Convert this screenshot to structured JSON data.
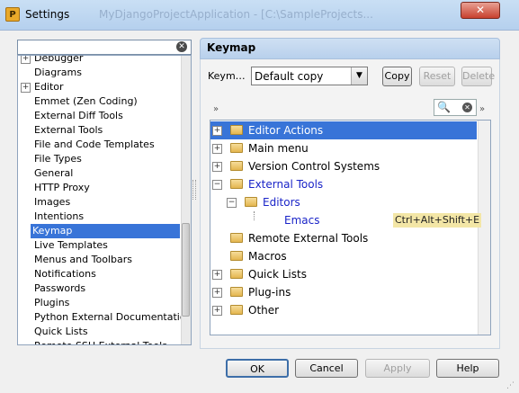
{
  "window": {
    "title": "Settings",
    "background_title": "MyDjangoProjectApplication - [C:\\SampleProjects..."
  },
  "search": {
    "value": "",
    "placeholder": ""
  },
  "settings_tree": [
    {
      "label": "Debugger",
      "expandable": true
    },
    {
      "label": "Diagrams"
    },
    {
      "label": "Editor",
      "expandable": true
    },
    {
      "label": "Emmet (Zen Coding)"
    },
    {
      "label": "External Diff Tools"
    },
    {
      "label": "External Tools"
    },
    {
      "label": "File and Code Templates"
    },
    {
      "label": "File Types"
    },
    {
      "label": "General"
    },
    {
      "label": "HTTP Proxy"
    },
    {
      "label": "Images"
    },
    {
      "label": "Intentions"
    },
    {
      "label": "Keymap",
      "selected": true
    },
    {
      "label": "Live Templates"
    },
    {
      "label": "Menus and Toolbars"
    },
    {
      "label": "Notifications"
    },
    {
      "label": "Passwords"
    },
    {
      "label": "Plugins"
    },
    {
      "label": "Python External Documentation"
    },
    {
      "label": "Quick Lists"
    },
    {
      "label": "Remote SSH External Tools"
    }
  ],
  "keymap": {
    "header": "Keymap",
    "keymaps_label": "Keym…",
    "selected_keymap": "Default copy",
    "copy_label": "Copy",
    "reset_label": "Reset",
    "delete_label": "Delete"
  },
  "toolbar": {
    "left_arrows": "»",
    "right_arrows": "»"
  },
  "action_tree": [
    {
      "label": "Editor Actions",
      "level": 0,
      "expander": "+",
      "selected": true
    },
    {
      "label": "Main menu",
      "level": 0,
      "expander": "+"
    },
    {
      "label": "Version Control Systems",
      "level": 0,
      "expander": "+"
    },
    {
      "label": "External Tools",
      "level": 0,
      "expander": "−",
      "blue": true
    },
    {
      "label": "Editors",
      "level": 1,
      "expander": "−",
      "blue": true
    },
    {
      "label": "Emacs",
      "level": 2,
      "blue": true,
      "shortcut": "Ctrl+Alt+Shift+E"
    },
    {
      "label": "Remote External Tools",
      "level": 0
    },
    {
      "label": "Macros",
      "level": 0
    },
    {
      "label": "Quick Lists",
      "level": 0,
      "expander": "+"
    },
    {
      "label": "Plug-ins",
      "level": 0,
      "expander": "+"
    },
    {
      "label": "Other",
      "level": 0,
      "expander": "+"
    }
  ],
  "buttons": {
    "ok": "OK",
    "cancel": "Cancel",
    "apply": "Apply",
    "help": "Help"
  },
  "colors": {
    "selection": "#3874d8",
    "shortcut_highlight": "#f3e6a6",
    "link_blue": "#1a24c8"
  }
}
